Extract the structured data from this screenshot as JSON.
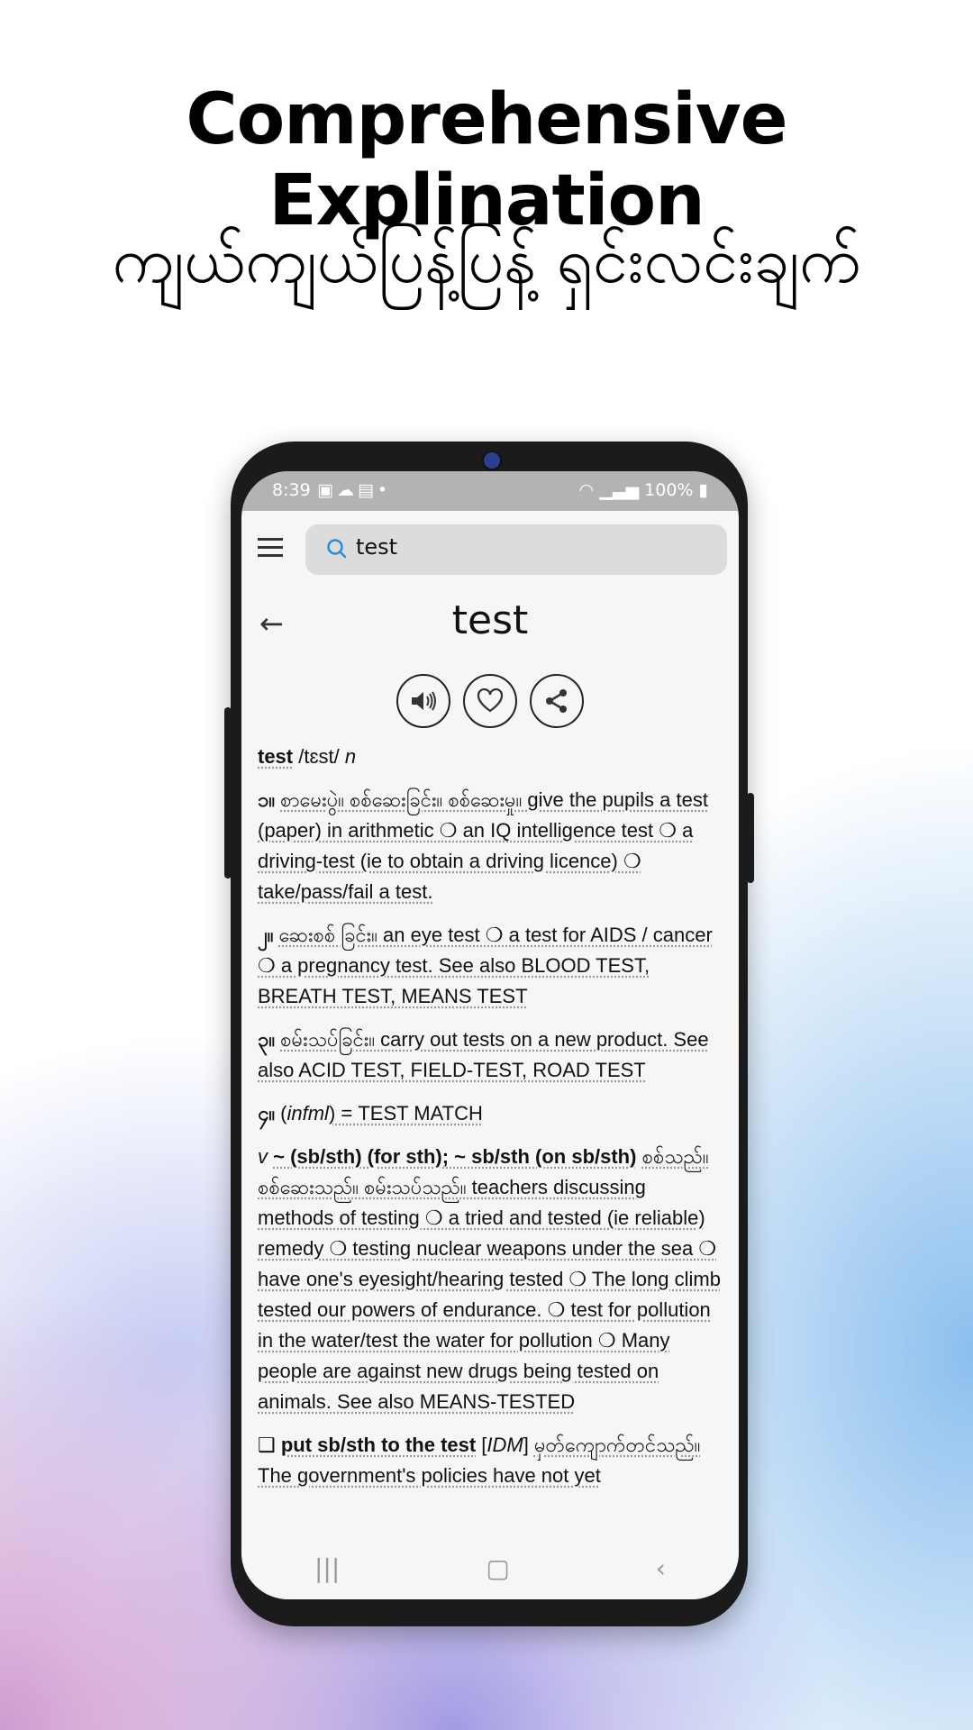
{
  "promo": {
    "title": "Comprehensive Explination",
    "subtitle": "ကျယ်ကျယ်ပြန့်ပြန့် ရှင်းလင်းချက်"
  },
  "status": {
    "time": "8:39",
    "left_icons": [
      "image-icon",
      "cloud-icon",
      "calendar-icon",
      "dot-icon"
    ],
    "battery": "100%"
  },
  "search": {
    "value": "test"
  },
  "entry": {
    "word": "test",
    "headword": "test",
    "pron": "/tɛst/",
    "pos": "n",
    "defs": [
      {
        "num": "၁။",
        "text": "စာမေးပွဲ။ စစ်ဆေးခြင်း။ စစ်ဆေးမှု။ give the pupils a test (paper) in arithmetic ❍ an IQ intelligence test ❍ a driving-test (ie to obtain a driving licence) ❍ take/pass/fail a test."
      },
      {
        "num": "၂။",
        "text": "ဆေးစစ် ခြင်း။ an eye test ❍ a test for AIDS / cancer ❍ a pregnancy test. See also BLOOD TEST, BREATH TEST, MEANS TEST"
      },
      {
        "num": "၃။",
        "text": "စမ်းသပ်ခြင်း။ carry out tests on a new product. See also ACID TEST, FIELD-TEST, ROAD TEST"
      },
      {
        "num": "၄။",
        "pre": "(",
        "ital": "infml",
        "text": ") = TEST MATCH"
      }
    ],
    "verb": {
      "pos": "v",
      "bold": "~ (sb/sth) (for sth); ~ sb/sth (on sb/sth)",
      "text": "စစ်သည်။ စစ်ဆေးသည်။ စမ်းသပ်သည်။ teachers discussing methods of testing ❍ a tried and tested (ie reliable) remedy ❍ testing nuclear weapons under the sea ❍ have one's eyesight/hearing tested ❍ The long climb tested our powers of endurance. ❍ test for pollution in the water/test the water for pollution ❍ Many people are against new drugs being tested on animals. See also MEANS-TESTED"
    },
    "idiom": {
      "marker": "❑",
      "bold": "put sb/sth to the test",
      "tag": "IDM",
      "text": "မှတ်ကျောက်တင်သည်။ The government's policies have not yet"
    }
  }
}
